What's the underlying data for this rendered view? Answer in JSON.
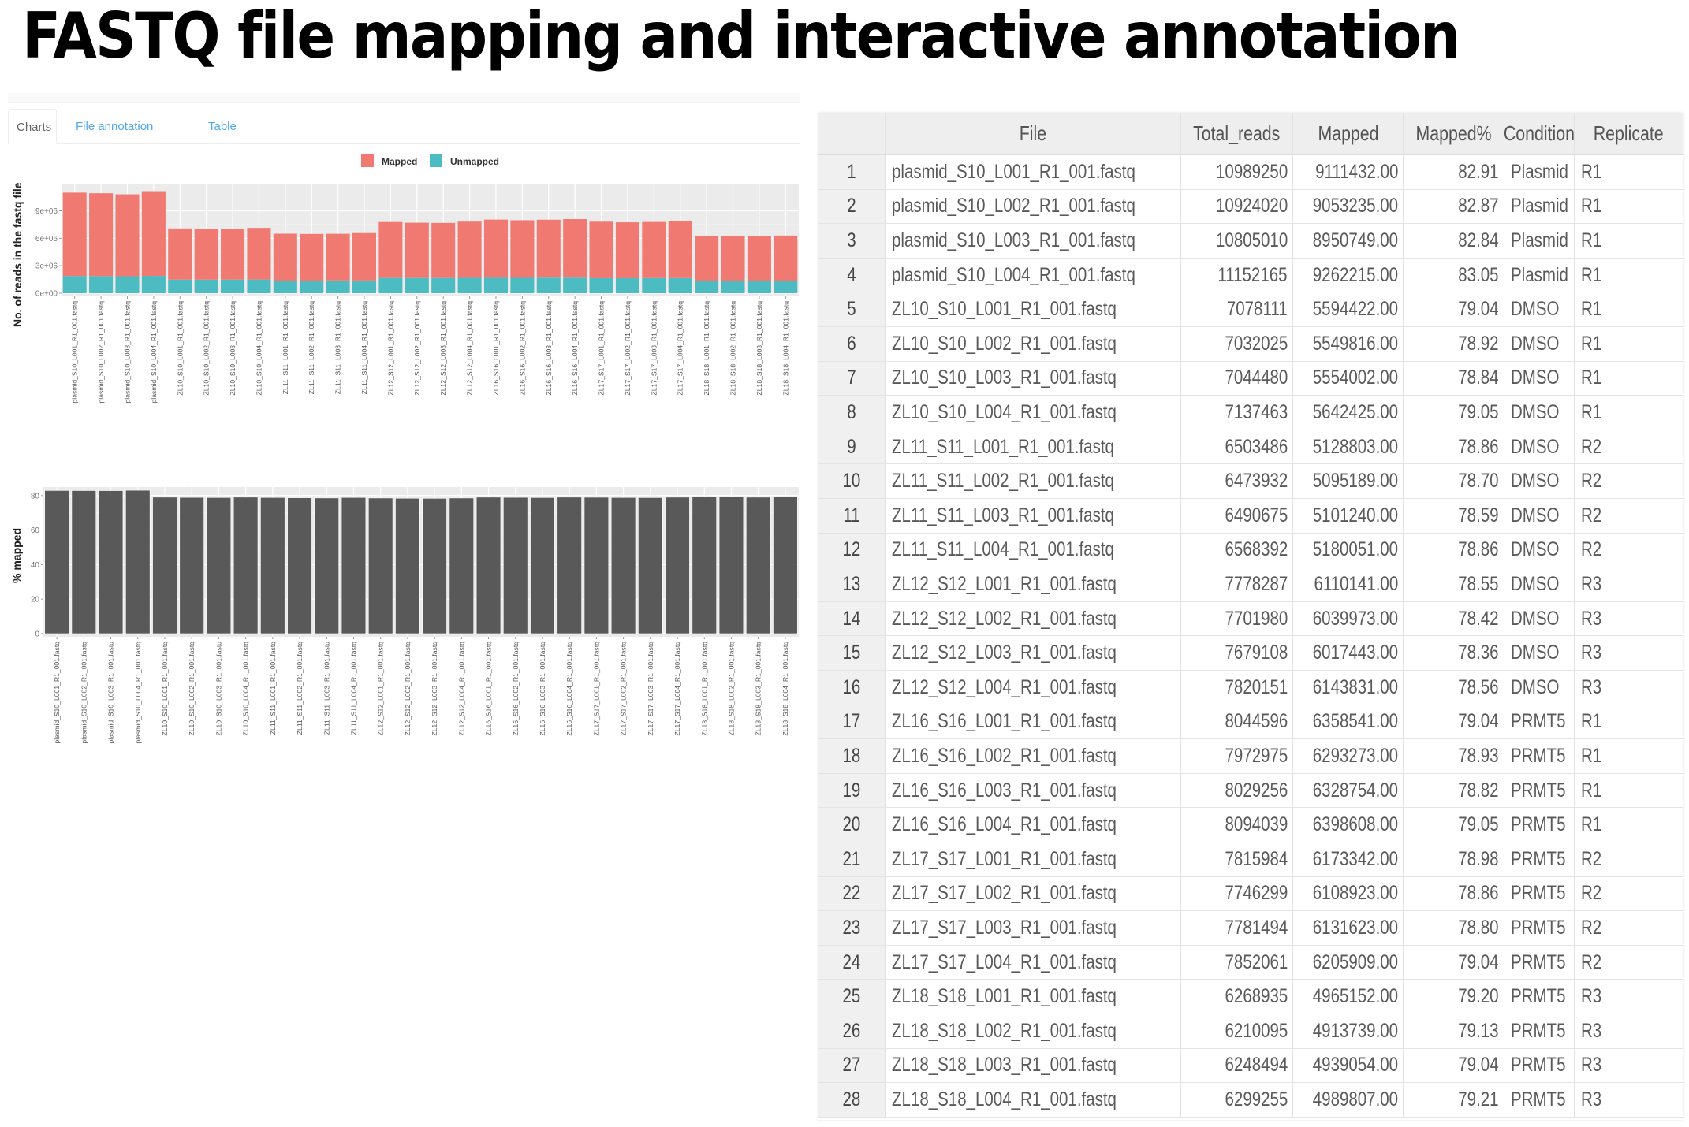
{
  "slide": {
    "title": "FASTQ file mapping and interactive annotation"
  },
  "app": {
    "tabs": [
      {
        "label": "Charts",
        "active": true
      },
      {
        "label": "File annotation",
        "active": false
      },
      {
        "label": "Table",
        "active": false
      }
    ]
  },
  "colors": {
    "mapped": "#f07a72",
    "unmapped": "#4cbcc2",
    "percent_bar": "#595959",
    "panel_bg": "#ebebeb",
    "tab_link": "#52a8ec"
  },
  "chart_data": [
    {
      "type": "bar",
      "stacked": true,
      "title": "",
      "xlabel": "",
      "ylabel": "No. of reads in the fastq file",
      "ylim": [
        0,
        11800000
      ],
      "yticks": [
        0,
        3000000,
        6000000,
        9000000
      ],
      "ytick_labels": [
        "0e+00",
        "3e+06",
        "6e+06",
        "9e+06"
      ],
      "legend": {
        "placement": "top",
        "entries": [
          "Mapped",
          "Unmapped"
        ]
      },
      "grid": true,
      "categories": [
        "plasmid_S10_L001_R1_001.fastq",
        "plasmid_S10_L002_R1_001.fastq",
        "plasmid_S10_L003_R1_001.fastq",
        "plasmid_S10_L004_R1_001.fastq",
        "ZL10_S10_L001_R1_001.fastq",
        "ZL10_S10_L002_R1_001.fastq",
        "ZL10_S10_L003_R1_001.fastq",
        "ZL10_S10_L004_R1_001.fastq",
        "ZL11_S11_L001_R1_001.fastq",
        "ZL11_S11_L002_R1_001.fastq",
        "ZL11_S11_L003_R1_001.fastq",
        "ZL11_S11_L004_R1_001.fastq",
        "ZL12_S12_L001_R1_001.fastq",
        "ZL12_S12_L002_R1_001.fastq",
        "ZL12_S12_L003_R1_001.fastq",
        "ZL12_S12_L004_R1_001.fastq",
        "ZL16_S16_L001_R1_001.fastq",
        "ZL16_S16_L002_R1_001.fastq",
        "ZL16_S16_L003_R1_001.fastq",
        "ZL16_S16_L004_R1_001.fastq",
        "ZL17_S17_L001_R1_001.fastq",
        "ZL17_S17_L002_R1_001.fastq",
        "ZL17_S17_L003_R1_001.fastq",
        "ZL17_S17_L004_R1_001.fastq",
        "ZL18_S18_L001_R1_001.fastq",
        "ZL18_S18_L002_R1_001.fastq",
        "ZL18_S18_L003_R1_001.fastq",
        "ZL18_S18_L004_R1_001.fastq"
      ],
      "series": [
        {
          "name": "Unmapped",
          "values": [
            1877818,
            1870785,
            1854261,
            1889950,
            1483689,
            1482209,
            1490478,
            1495038,
            1374683,
            1378743,
            1389435,
            1388341,
            1668146,
            1662007,
            1661665,
            1676320,
            1686055,
            1679702,
            1700502,
            1695431,
            1642642,
            1637376,
            1649871,
            1646152,
            1303783,
            1296356,
            1309440,
            1309448
          ]
        },
        {
          "name": "Mapped",
          "values": [
            9111432,
            9053235,
            8950749,
            9262215,
            5594422,
            5549816,
            5554002,
            5642425,
            5128803,
            5095189,
            5101240,
            5180051,
            6110141,
            6039973,
            6017443,
            6143831,
            6358541,
            6293273,
            6328754,
            6398608,
            6173342,
            6108923,
            6131623,
            6205909,
            4965152,
            4913739,
            4939054,
            4989807
          ]
        }
      ]
    },
    {
      "type": "bar",
      "title": "",
      "xlabel": "",
      "ylabel": "% mapped",
      "ylim": [
        0,
        84
      ],
      "yticks": [
        0,
        20,
        40,
        60,
        80
      ],
      "ytick_labels": [
        "0",
        "20",
        "40",
        "60",
        "80"
      ],
      "grid": true,
      "categories_ref": "same as chart 1",
      "values": [
        82.91,
        82.87,
        82.84,
        83.05,
        79.04,
        78.92,
        78.84,
        79.05,
        78.86,
        78.7,
        78.59,
        78.86,
        78.55,
        78.42,
        78.36,
        78.56,
        79.04,
        78.93,
        78.82,
        79.05,
        78.98,
        78.86,
        78.8,
        79.04,
        79.2,
        79.13,
        79.04,
        79.21
      ]
    }
  ],
  "table": {
    "headers": [
      "",
      "File",
      "Total_reads",
      "Mapped",
      "Mapped%",
      "Condition",
      "Replicate"
    ],
    "rows": [
      [
        "1",
        "plasmid_S10_L001_R1_001.fastq",
        "10989250",
        "9111432.00",
        "82.91",
        "Plasmid",
        "R1"
      ],
      [
        "2",
        "plasmid_S10_L002_R1_001.fastq",
        "10924020",
        "9053235.00",
        "82.87",
        "Plasmid",
        "R1"
      ],
      [
        "3",
        "plasmid_S10_L003_R1_001.fastq",
        "10805010",
        "8950749.00",
        "82.84",
        "Plasmid",
        "R1"
      ],
      [
        "4",
        "plasmid_S10_L004_R1_001.fastq",
        "11152165",
        "9262215.00",
        "83.05",
        "Plasmid",
        "R1"
      ],
      [
        "5",
        "ZL10_S10_L001_R1_001.fastq",
        "7078111",
        "5594422.00",
        "79.04",
        "DMSO",
        "R1"
      ],
      [
        "6",
        "ZL10_S10_L002_R1_001.fastq",
        "7032025",
        "5549816.00",
        "78.92",
        "DMSO",
        "R1"
      ],
      [
        "7",
        "ZL10_S10_L003_R1_001.fastq",
        "7044480",
        "5554002.00",
        "78.84",
        "DMSO",
        "R1"
      ],
      [
        "8",
        "ZL10_S10_L004_R1_001.fastq",
        "7137463",
        "5642425.00",
        "79.05",
        "DMSO",
        "R1"
      ],
      [
        "9",
        "ZL11_S11_L001_R1_001.fastq",
        "6503486",
        "5128803.00",
        "78.86",
        "DMSO",
        "R2"
      ],
      [
        "10",
        "ZL11_S11_L002_R1_001.fastq",
        "6473932",
        "5095189.00",
        "78.70",
        "DMSO",
        "R2"
      ],
      [
        "11",
        "ZL11_S11_L003_R1_001.fastq",
        "6490675",
        "5101240.00",
        "78.59",
        "DMSO",
        "R2"
      ],
      [
        "12",
        "ZL11_S11_L004_R1_001.fastq",
        "6568392",
        "5180051.00",
        "78.86",
        "DMSO",
        "R2"
      ],
      [
        "13",
        "ZL12_S12_L001_R1_001.fastq",
        "7778287",
        "6110141.00",
        "78.55",
        "DMSO",
        "R3"
      ],
      [
        "14",
        "ZL12_S12_L002_R1_001.fastq",
        "7701980",
        "6039973.00",
        "78.42",
        "DMSO",
        "R3"
      ],
      [
        "15",
        "ZL12_S12_L003_R1_001.fastq",
        "7679108",
        "6017443.00",
        "78.36",
        "DMSO",
        "R3"
      ],
      [
        "16",
        "ZL12_S12_L004_R1_001.fastq",
        "7820151",
        "6143831.00",
        "78.56",
        "DMSO",
        "R3"
      ],
      [
        "17",
        "ZL16_S16_L001_R1_001.fastq",
        "8044596",
        "6358541.00",
        "79.04",
        "PRMT5",
        "R1"
      ],
      [
        "18",
        "ZL16_S16_L002_R1_001.fastq",
        "7972975",
        "6293273.00",
        "78.93",
        "PRMT5",
        "R1"
      ],
      [
        "19",
        "ZL16_S16_L003_R1_001.fastq",
        "8029256",
        "6328754.00",
        "78.82",
        "PRMT5",
        "R1"
      ],
      [
        "20",
        "ZL16_S16_L004_R1_001.fastq",
        "8094039",
        "6398608.00",
        "79.05",
        "PRMT5",
        "R1"
      ],
      [
        "21",
        "ZL17_S17_L001_R1_001.fastq",
        "7815984",
        "6173342.00",
        "78.98",
        "PRMT5",
        "R2"
      ],
      [
        "22",
        "ZL17_S17_L002_R1_001.fastq",
        "7746299",
        "6108923.00",
        "78.86",
        "PRMT5",
        "R2"
      ],
      [
        "23",
        "ZL17_S17_L003_R1_001.fastq",
        "7781494",
        "6131623.00",
        "78.80",
        "PRMT5",
        "R2"
      ],
      [
        "24",
        "ZL17_S17_L004_R1_001.fastq",
        "7852061",
        "6205909.00",
        "79.04",
        "PRMT5",
        "R2"
      ],
      [
        "25",
        "ZL18_S18_L001_R1_001.fastq",
        "6268935",
        "4965152.00",
        "79.20",
        "PRMT5",
        "R3"
      ],
      [
        "26",
        "ZL18_S18_L002_R1_001.fastq",
        "6210095",
        "4913739.00",
        "79.13",
        "PRMT5",
        "R3"
      ],
      [
        "27",
        "ZL18_S18_L003_R1_001.fastq",
        "6248494",
        "4939054.00",
        "79.04",
        "PRMT5",
        "R3"
      ],
      [
        "28",
        "ZL18_S18_L004_R1_001.fastq",
        "6299255",
        "4989807.00",
        "79.21",
        "PRMT5",
        "R3"
      ]
    ]
  }
}
